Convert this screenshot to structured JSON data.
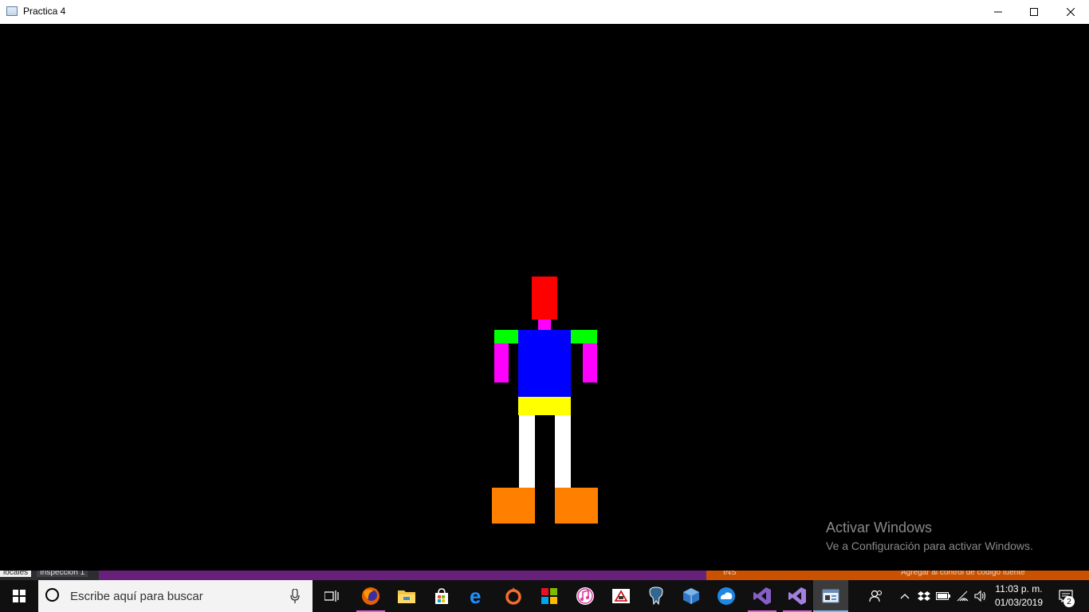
{
  "window": {
    "title": "Practica 4",
    "minimize_icon": "minimize-icon",
    "maximize_icon": "maximize-icon",
    "close_icon": "close-icon"
  },
  "scene": {
    "background": "#000000",
    "figure_parts": [
      {
        "name": "head",
        "color": "#ff0000"
      },
      {
        "name": "neck",
        "color": "#ff00ff"
      },
      {
        "name": "torso",
        "color": "#0000ff"
      },
      {
        "name": "left-shoulder",
        "color": "#00ff00"
      },
      {
        "name": "right-shoulder",
        "color": "#00ff00"
      },
      {
        "name": "left-arm",
        "color": "#ff00ff"
      },
      {
        "name": "right-arm",
        "color": "#ff00ff"
      },
      {
        "name": "hips",
        "color": "#ffff00"
      },
      {
        "name": "left-leg",
        "color": "#ffffff"
      },
      {
        "name": "right-leg",
        "color": "#ffffff"
      },
      {
        "name": "left-foot",
        "color": "#ff8000"
      },
      {
        "name": "right-foot",
        "color": "#ff8000"
      }
    ]
  },
  "activation": {
    "title": "Activar Windows",
    "subtitle": "Ve a Configuración para activar Windows."
  },
  "background_window": {
    "tab_1": "locales",
    "tab_2": "Inspección 1",
    "status_ins": "INS",
    "status_source": "Agregar al control de código fuente"
  },
  "taskbar": {
    "search_placeholder": "Escribe aquí para buscar",
    "apps": [
      "task-view-icon",
      "firefox-icon",
      "file-explorer-icon",
      "store-icon",
      "edge-icon",
      "origin-icon",
      "office-icon",
      "itunes-icon",
      "paint-app-icon",
      "postgres-icon",
      "virtualbox-icon",
      "cloud-app-icon",
      "visual-studio-icon",
      "visual-studio-2-icon",
      "practica-window-icon"
    ],
    "clock_time": "11:03 p. m.",
    "clock_date": "01/03/2019",
    "notification_count": "2"
  }
}
